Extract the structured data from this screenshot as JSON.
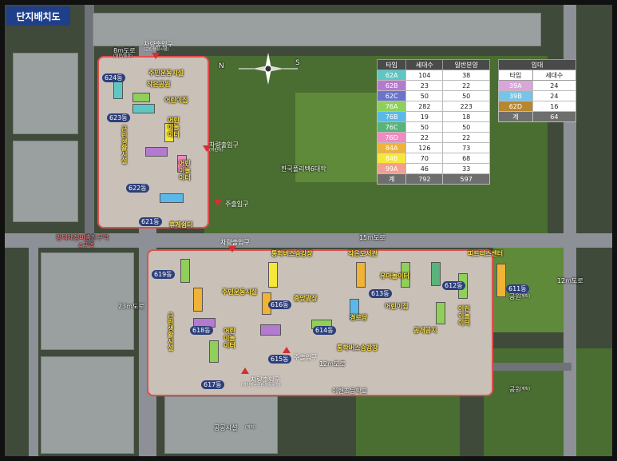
{
  "title": "단지배치도",
  "colors": {
    "accent": "#1f3f8a",
    "site_border": "#e14e4e"
  },
  "compass": {
    "n": "N",
    "s": "S",
    "icon": "compass-rose-icon"
  },
  "roads": {
    "r8m": "8m도로",
    "r8m_sub": "(일반/통과)",
    "r15m": "15m도로",
    "r23m": "23m도로",
    "r12m_right": "12m도로",
    "r12m_bottom": "12m도로"
  },
  "places": {
    "university": "한국폴리텍6대학",
    "redev": "평택재정비촉진구역",
    "redev2": "4구역",
    "school": "이현초등학교",
    "park1": "공원",
    "park1_sub": "(계획)",
    "park2": "공원",
    "park2_sub": "(계획)",
    "public": "공공시설",
    "public_sub": "(계획)"
  },
  "gates": {
    "north_top": "차량출입구",
    "north_top_sub": "(근린생활시설)",
    "north_mid": "차량출입구",
    "north_mid_sub": "(어린이)",
    "main": "주출입구",
    "center": "차량출입구",
    "south_main": "주출입구",
    "south_car": "차량출입구",
    "south_car_sub": "(어린이+근린생활시설)"
  },
  "facilities": {
    "north_sports": "주민운동시설",
    "north_kids": "어린이집",
    "north_garden": "작은공원",
    "north_play": "어린이놀이터",
    "north_play2": "어린이놀이터",
    "rest": "휴게쉼터",
    "strip_north": "근린생활시설",
    "strip_south": "근린생활시설",
    "school_walk_n": "통학버스승강장",
    "small_lib": "작은도서관",
    "fitness": "피트니스센터",
    "south_sports": "주민운동시설",
    "central_plaza": "중앙광장",
    "kids_play": "유아놀이터",
    "south_kids": "어린이집",
    "south_play1": "어린이놀이터",
    "south_play2": "어린이놀이터",
    "exchange": "경로당",
    "public_path": "공개공지",
    "school_walk_s": "통학버스승강장"
  },
  "dongs": [
    "624동",
    "623동",
    "622동",
    "621동",
    "619동",
    "618동",
    "617동",
    "616동",
    "615동",
    "614동",
    "613동",
    "612동",
    "611동"
  ],
  "sale_table": {
    "headers": [
      "타입",
      "세대수",
      "일반분양"
    ],
    "rows": [
      {
        "type": "62A",
        "units": "104",
        "sale": "38",
        "color": "#5ec7c4"
      },
      {
        "type": "62B",
        "units": "23",
        "sale": "22",
        "color": "#b47ad0"
      },
      {
        "type": "62C",
        "units": "50",
        "sale": "50",
        "color": "#6b74c9"
      },
      {
        "type": "76A",
        "units": "282",
        "sale": "223",
        "color": "#8fcf5a"
      },
      {
        "type": "76B",
        "units": "19",
        "sale": "18",
        "color": "#5cb8e8"
      },
      {
        "type": "76C",
        "units": "50",
        "sale": "50",
        "color": "#59b37a"
      },
      {
        "type": "76D",
        "units": "22",
        "sale": "22",
        "color": "#f08ac0"
      },
      {
        "type": "84A",
        "units": "126",
        "sale": "73",
        "color": "#f0b335"
      },
      {
        "type": "84B",
        "units": "70",
        "sale": "68",
        "color": "#f5e83a"
      },
      {
        "type": "99A",
        "units": "46",
        "sale": "33",
        "color": "#f0a090"
      }
    ],
    "total": {
      "type": "계",
      "units": "792",
      "sale": "597"
    }
  },
  "rent_table": {
    "caption": "임대",
    "headers": [
      "타입",
      "세대수"
    ],
    "rows": [
      {
        "type": "39A",
        "units": "24",
        "color": "#d9a6d9"
      },
      {
        "type": "39B",
        "units": "24",
        "color": "#78c4e8"
      },
      {
        "type": "62D",
        "units": "16",
        "color": "#b8862e"
      }
    ],
    "total": {
      "type": "계",
      "units": "64"
    }
  }
}
